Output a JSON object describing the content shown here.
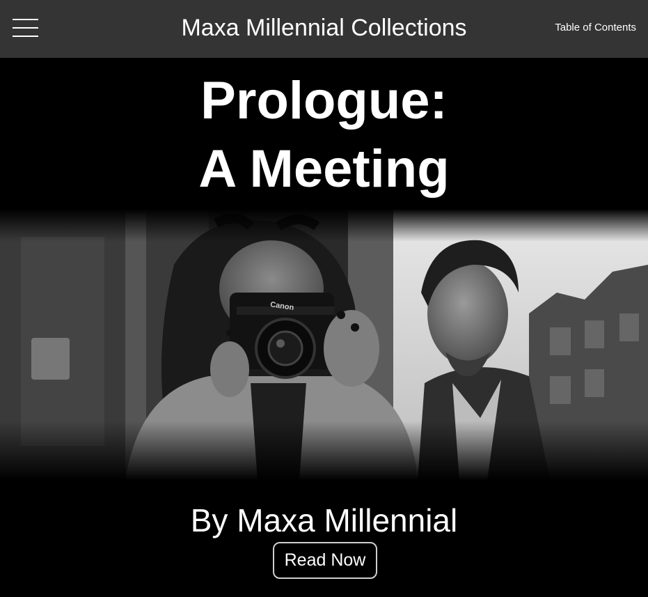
{
  "header": {
    "menu_icon": "hamburger-menu-icon",
    "title": "Maxa Millennial Collections",
    "toc_label": "Table of Contents"
  },
  "chapter": {
    "title_line1": "Prologue:",
    "title_line2": "A Meeting"
  },
  "hero_image": {
    "description": "Black and white photo of a woman holding a camera and a man looking upward",
    "camera_brand": "Canon"
  },
  "byline": "By Maxa Millennial",
  "cta_label": "Read Now",
  "colors": {
    "header_bg": "#343434",
    "page_bg": "#000000",
    "text": "#ffffff",
    "button_border": "#cfcfcf"
  }
}
